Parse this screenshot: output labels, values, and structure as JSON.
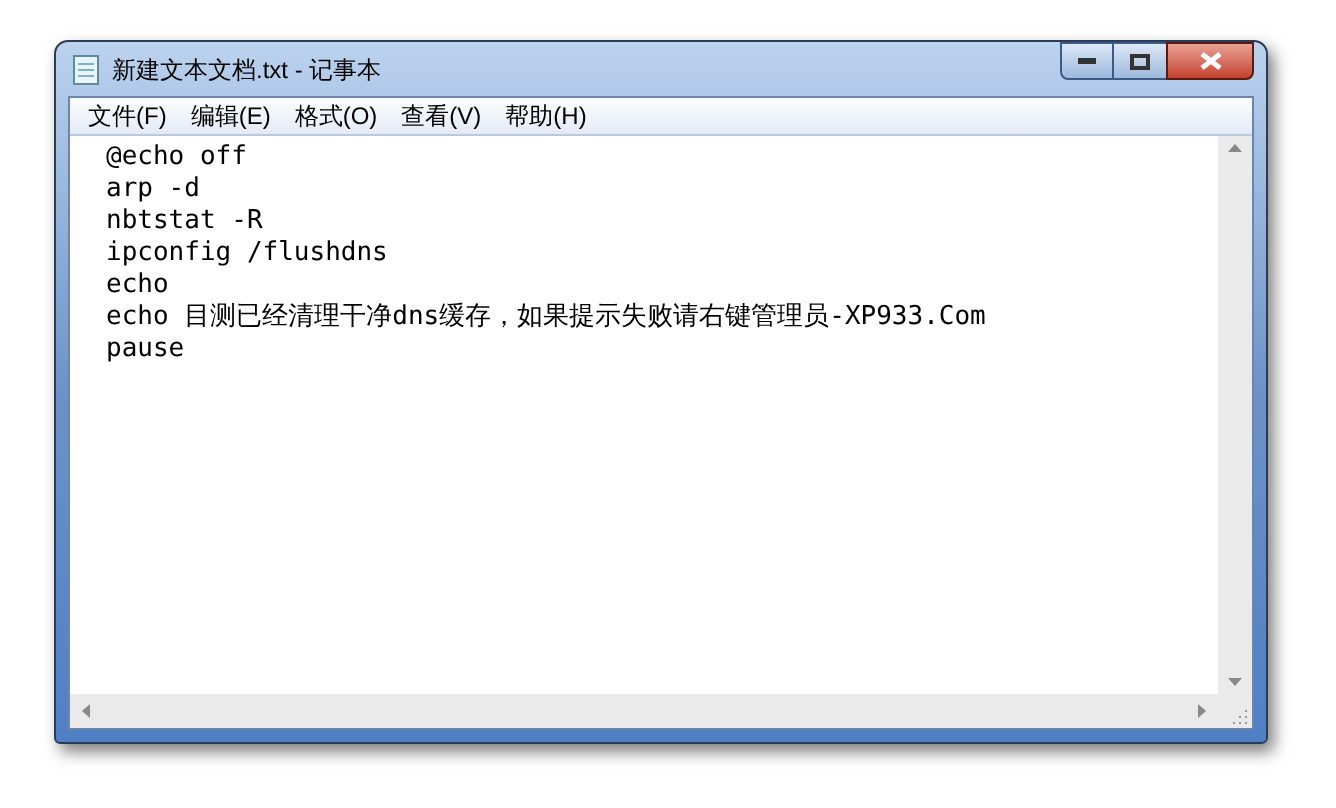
{
  "window": {
    "title": "新建文本文档.txt - 记事本"
  },
  "menu": [
    "文件(F)",
    "编辑(E)",
    "格式(O)",
    "查看(V)",
    "帮助(H)"
  ],
  "editor": {
    "lines": [
      "@echo off",
      "arp -d",
      "nbtstat -R",
      "ipconfig /flushdns",
      "echo",
      "echo 目测已经清理干净dns缓存，如果提示失败请右键管理员-XP933.Com",
      "pause"
    ]
  }
}
